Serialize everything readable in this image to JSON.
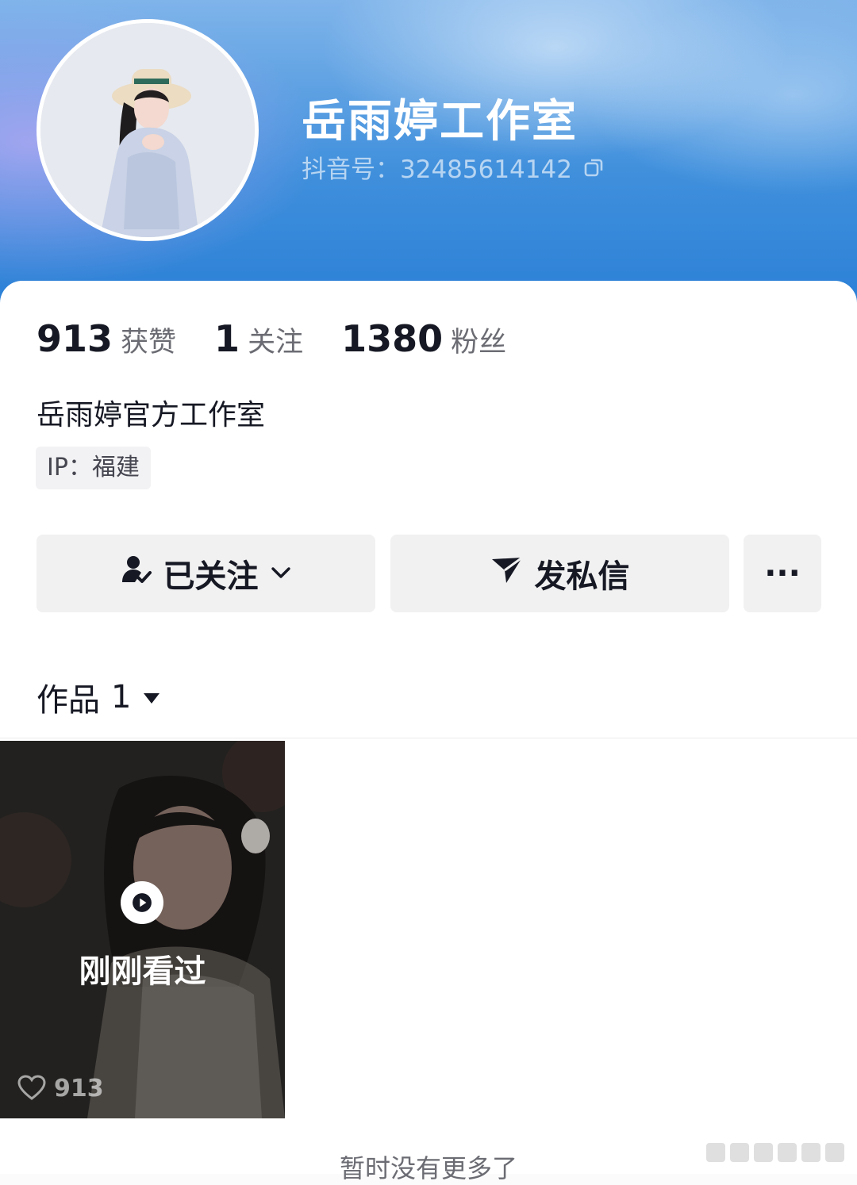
{
  "profile": {
    "name": "岳雨婷工作室",
    "douyin_id": "抖音号：32485614142",
    "bio": "岳雨婷官方工作室",
    "ip": "IP：福建"
  },
  "stats": [
    {
      "value": "913",
      "label": "获赞"
    },
    {
      "value": "1",
      "label": "关注"
    },
    {
      "value": "1380",
      "label": "粉丝"
    }
  ],
  "actions": {
    "follow_label": "已关注",
    "message_label": "发私信",
    "more_label": "···"
  },
  "works": {
    "tab_label": "作品",
    "count": "1"
  },
  "video": {
    "overlay_label": "刚刚看过",
    "likes": "913"
  },
  "footer": {
    "no_more": "暂时没有更多了"
  },
  "icons": [
    "copy-icon",
    "user-check-icon",
    "chevron-down-icon",
    "send-icon",
    "more-icon",
    "dropdown-triangle-icon",
    "play-icon",
    "heart-icon"
  ],
  "colors": {
    "header_blue": "#2a7fd6",
    "text_primary": "#161823",
    "text_secondary": "#6b6c73",
    "button_bg": "#f1f1f2"
  }
}
